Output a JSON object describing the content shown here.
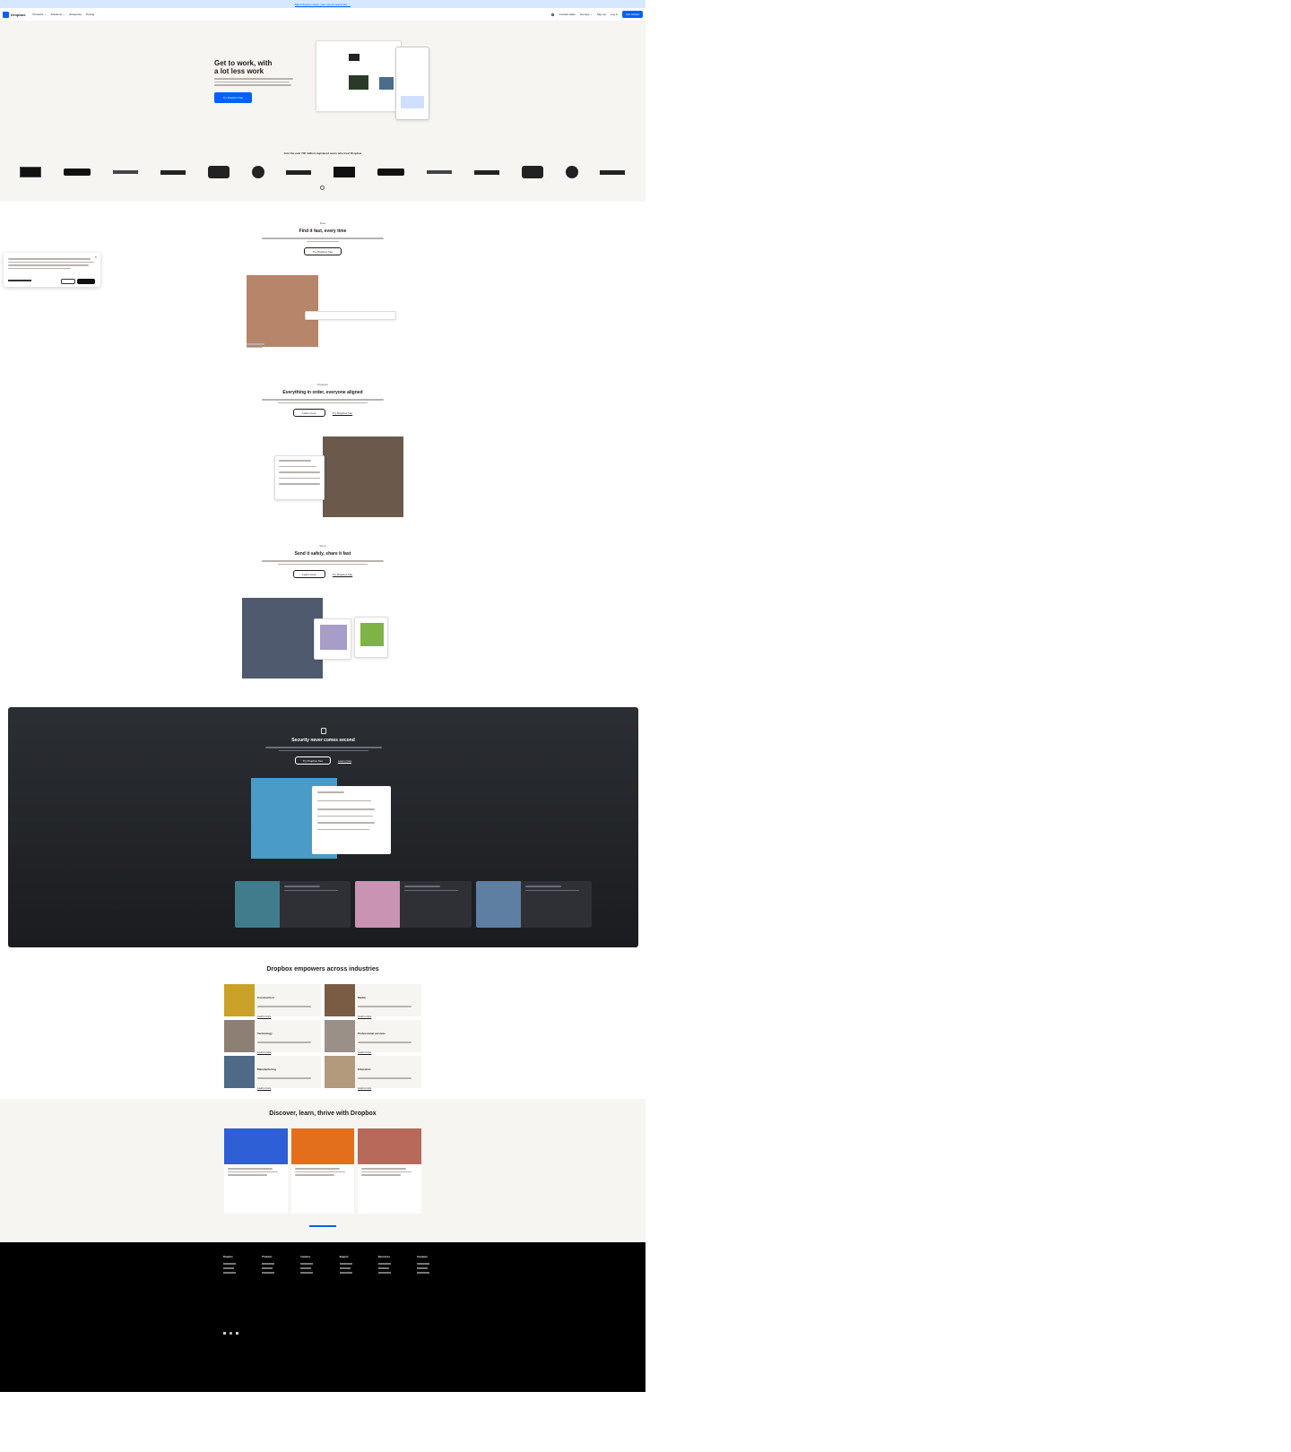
{
  "banner": {
    "text": "Meet Dropbox Dash, your new AI teammate →"
  },
  "nav": {
    "brand": "Dropbox",
    "items": [
      "Products ⌄",
      "Solutions ⌄",
      "Enterprise",
      "Pricing"
    ],
    "right": [
      "Contact sales",
      "Get app ⌄",
      "Sign up",
      "Log in"
    ],
    "cta": "Get started"
  },
  "hero": {
    "title_line1": "Get to work, with",
    "title_line2": "a lot less work",
    "button": "Try Dropbox free"
  },
  "logos": {
    "heading": "Join the over 700 million registered users who trust Dropbox"
  },
  "feat1": {
    "eyebrow": "Files",
    "title": "Find it fast, every time",
    "button": "Try Dropbox free"
  },
  "feat2": {
    "eyebrow": "Organize",
    "title": "Everything in order, everyone aligned",
    "button": "Learn more",
    "link": "Try Dropbox free"
  },
  "feat3": {
    "eyebrow": "Send",
    "title": "Send it safely, share it fast",
    "button": "Learn more",
    "link": "Try Dropbox free"
  },
  "security": {
    "title": "Security never comes second",
    "button": "Try Dropbox free",
    "link": "Learn more"
  },
  "industries": {
    "title": "Dropbox empowers across industries",
    "items": [
      {
        "name": "Construction",
        "link": "Learn more"
      },
      {
        "name": "Media",
        "link": "Learn more"
      },
      {
        "name": "Technology",
        "link": "Learn more"
      },
      {
        "name": "Professional services",
        "link": "Learn more"
      },
      {
        "name": "Manufacturing",
        "link": "Learn more"
      },
      {
        "name": "Education",
        "link": "Learn more"
      }
    ]
  },
  "discover": {
    "title": "Discover, learn, thrive with Dropbox"
  },
  "footer": {
    "columns": [
      "Dropbox",
      "Products",
      "Features",
      "Support",
      "Resources",
      "Company"
    ]
  },
  "colors": {
    "blue": "#0061fe",
    "cream": "#f7f5f2",
    "dark": "#1f2225",
    "black": "#000000"
  }
}
